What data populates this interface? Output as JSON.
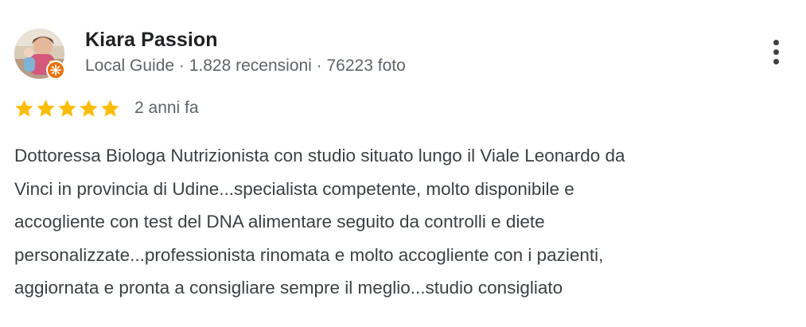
{
  "review": {
    "author": {
      "name": "Kiara Passion",
      "meta": "Local Guide · 1.828 recensioni · 76223 foto",
      "avatar_icon": "user-avatar-photo",
      "badge_icon": "local-guide-badge-icon"
    },
    "menu_icon": "more-vert-icon",
    "rating": {
      "stars": 5,
      "max": 5,
      "star_color": "#fbbc04"
    },
    "date": "2 anni fa",
    "text": "Dottoressa Biologa Nutrizionista con studio situato lungo il Viale Leonardo da\nVinci in provincia di Udine...specialista competente, molto disponibile e\naccogliente con test del DNA alimentare seguito da controlli e diete\npersonalizzate...professionista rinomata e molto accogliente con i pazienti,\naggiornata e pronta a consigliare sempre il meglio...studio consigliato"
  },
  "colors": {
    "name": "#202124",
    "meta": "#5f6368",
    "body": "#3c4043",
    "badge": "#e8710a"
  }
}
